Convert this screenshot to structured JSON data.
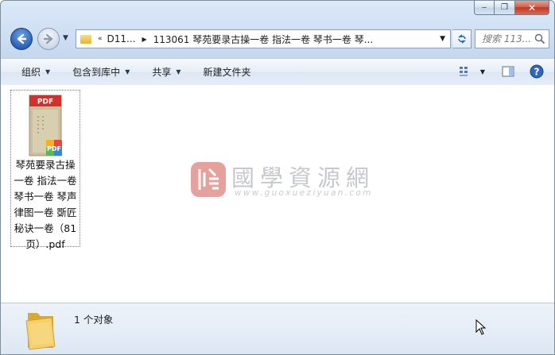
{
  "window": {
    "caption": {
      "min": "‒",
      "max": "❐",
      "close": "✕"
    }
  },
  "nav": {
    "address": {
      "chevron": "«",
      "crumbs": [
        "D11...",
        "113061 琴苑要录古操一卷 指法一卷 琴书一卷 琴..."
      ]
    },
    "search": {
      "placeholder": "搜索 113..."
    }
  },
  "toolbar": {
    "organize": "组织",
    "include_library": "包含到库中",
    "share": "共享",
    "new_folder": "新建文件夹"
  },
  "files": [
    {
      "name": "琴苑要录古操一卷 指法一卷 琴书一卷 琴声律图一卷 斲匠秘诀一卷（81页）.pdf",
      "type_badge": "PDF",
      "icon": "pdf-file-icon"
    }
  ],
  "watermark": {
    "title": "國學資源網",
    "url": "www.guoxueziyuan.com"
  },
  "details": {
    "count_text": "1 个对象"
  },
  "colors": {
    "window_frame": "#cfe0f4",
    "toolbar": "#e7eef8",
    "close_red": "#c0391f",
    "pdf_red": "#d2302a",
    "watermark_red": "#d9534f"
  }
}
